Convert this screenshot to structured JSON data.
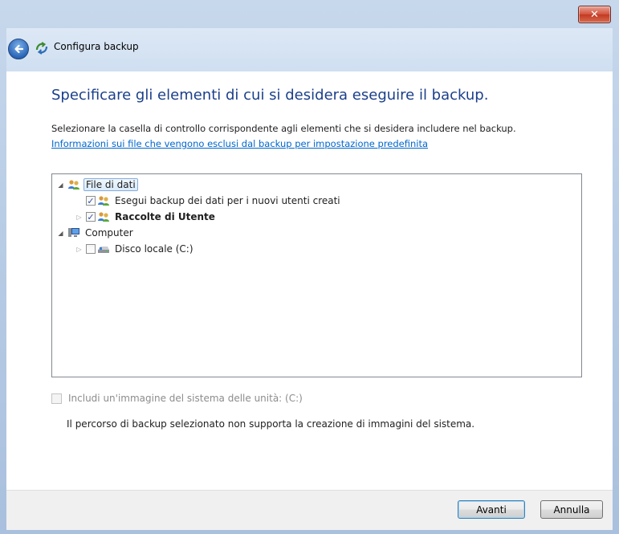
{
  "window": {
    "close_label": "✕"
  },
  "header": {
    "title": "Configura backup"
  },
  "main": {
    "heading": "Specificare gli elementi di cui si desidera eseguire il backup.",
    "instructions": "Selezionare la casella di controllo corrispondente agli elementi che si desidera includere nel backup.",
    "info_link": "Informazioni sui file che vengono esclusi dal backup per impostazione predefinita"
  },
  "tree": {
    "items": [
      {
        "label": "File di dati",
        "level": 0,
        "expander": "expanded",
        "checkbox": false,
        "selected": true,
        "icon": "users-icon"
      },
      {
        "label": "Esegui backup dei dati per i nuovi utenti creati",
        "level": 1,
        "expander": "none",
        "checkbox": true,
        "checked": true,
        "icon": "users-icon"
      },
      {
        "label": "Raccolte di Utente",
        "level": 1,
        "expander": "collapsed",
        "checkbox": true,
        "checked": true,
        "bold": true,
        "icon": "users-icon"
      },
      {
        "label": "Computer",
        "level": 0,
        "expander": "expanded",
        "checkbox": false,
        "icon": "computer-icon"
      },
      {
        "label": "Disco locale (C:)",
        "level": 1,
        "expander": "collapsed",
        "checkbox": true,
        "checked": false,
        "icon": "drive-icon"
      }
    ]
  },
  "system_image": {
    "label": "Includi un'immagine del sistema delle unità: (C:)",
    "checked": false,
    "disabled": true,
    "note": "Il percorso di backup selezionato non supporta la creazione di immagini del sistema."
  },
  "buttons": {
    "next": "Avanti",
    "cancel": "Annulla"
  },
  "colors": {
    "heading": "#1b3f8a",
    "link": "#0066cc",
    "frame": "#b9cde6"
  }
}
